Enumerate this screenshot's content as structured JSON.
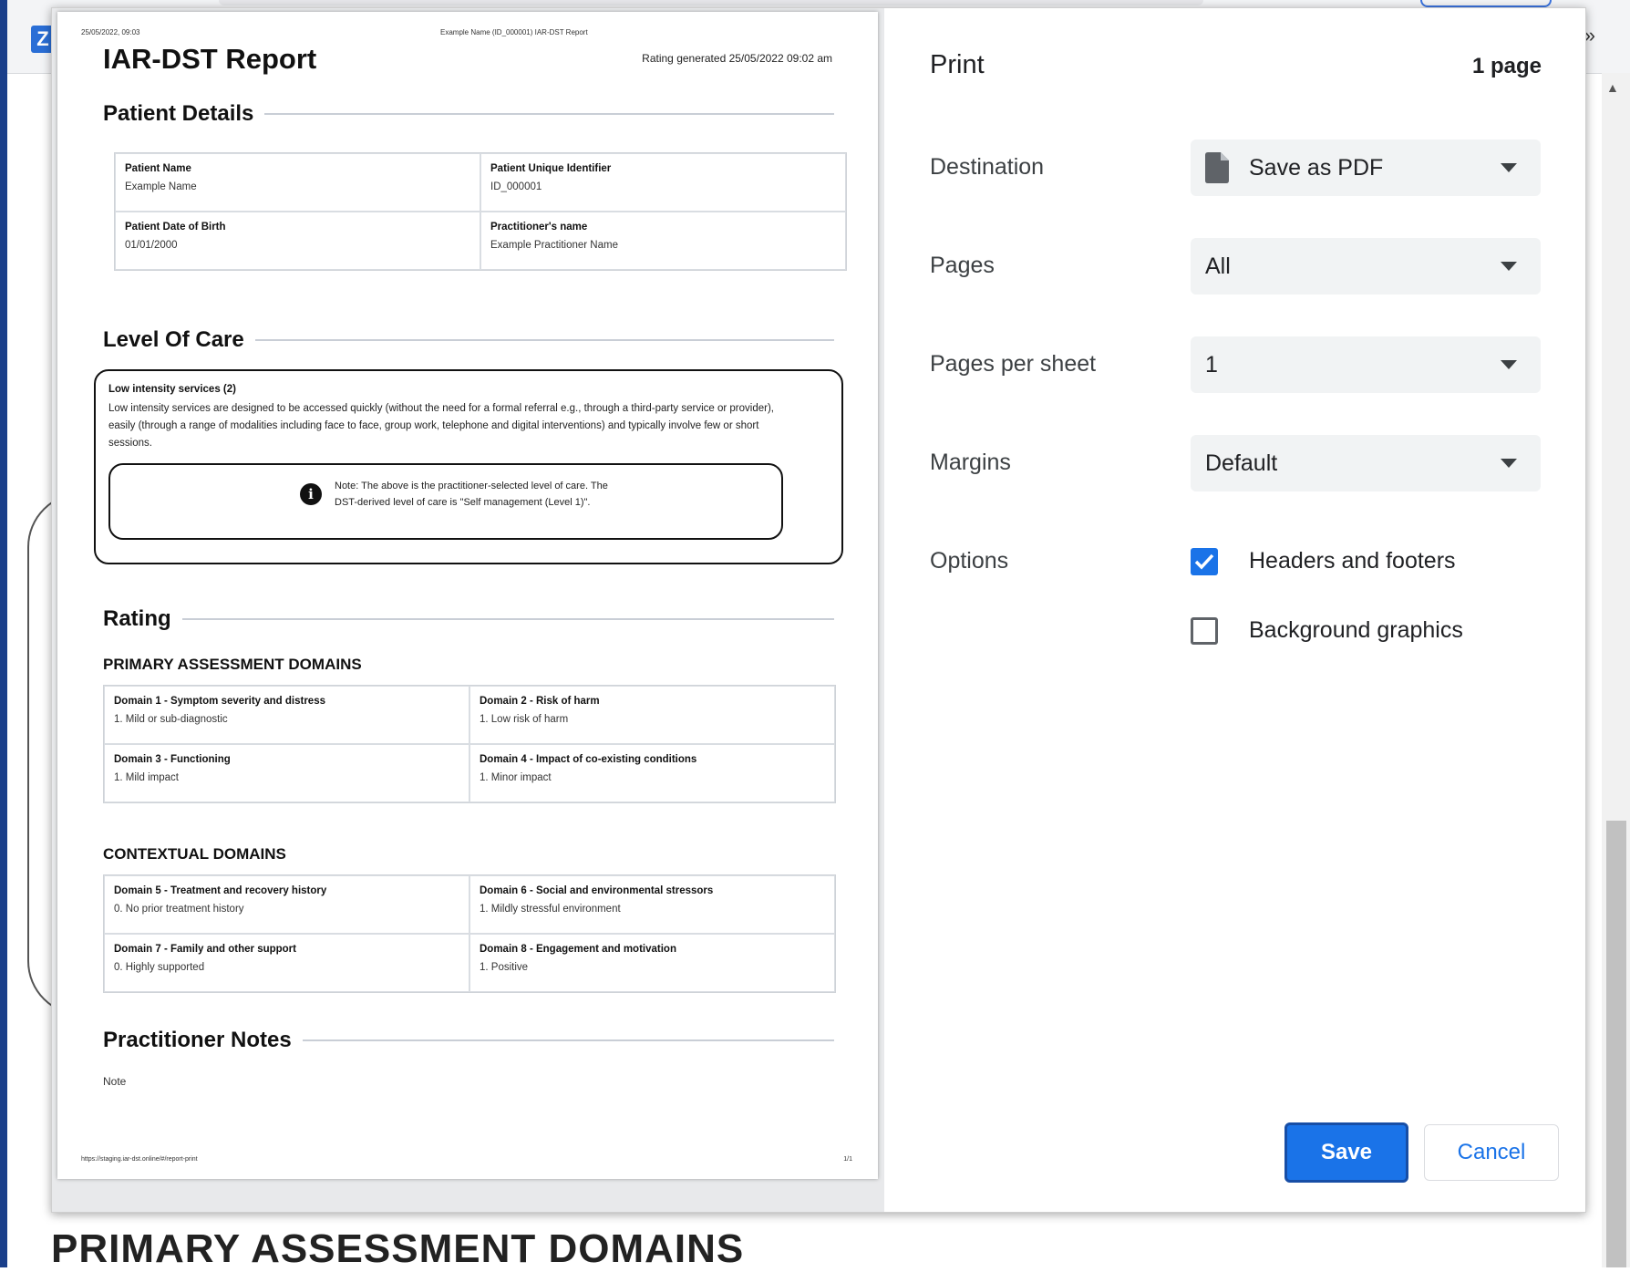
{
  "background": {
    "heading": "PRIMARY ASSESSMENT DOMAINS"
  },
  "preview": {
    "header_left": "25/05/2022, 09:03",
    "header_center": "Example Name (ID_000001) IAR-DST Report",
    "footer_left": "https://staging.iar-dst.online/#/report-print",
    "footer_right": "1/1",
    "title": "IAR-DST Report",
    "rating_generated": "Rating generated 25/05/2022 09:02 am",
    "patient_details": {
      "heading": "Patient Details",
      "fields": [
        {
          "label": "Patient Name",
          "value": "Example Name"
        },
        {
          "label": "Patient Unique Identifier",
          "value": "ID_000001"
        },
        {
          "label": "Patient Date of Birth",
          "value": "01/01/2000"
        },
        {
          "label": "Practitioner's name",
          "value": "Example Practitioner Name"
        }
      ]
    },
    "level_of_care": {
      "heading": "Level Of Care",
      "title": "Low intensity services (2)",
      "description": "Low intensity services are designed to be accessed quickly (without the need for a formal referral e.g., through a third-party service or provider), easily (through a range of modalities including face to face, group work, telephone and digital interventions) and typically involve few or short sessions.",
      "note": "Note: The above is the practitioner-selected level of care. The DST-derived level of care is \"Self management (Level 1)\"."
    },
    "rating": {
      "heading": "Rating",
      "primary_heading": "PRIMARY ASSESSMENT DOMAINS",
      "primary": [
        {
          "label": "Domain 1 - Symptom severity and distress",
          "value": "1. Mild or sub-diagnostic"
        },
        {
          "label": "Domain 2 - Risk of harm",
          "value": "1. Low risk of harm"
        },
        {
          "label": "Domain 3 - Functioning",
          "value": "1. Mild impact"
        },
        {
          "label": "Domain 4 - Impact of co-existing conditions",
          "value": "1. Minor impact"
        }
      ],
      "contextual_heading": "CONTEXTUAL DOMAINS",
      "contextual": [
        {
          "label": "Domain 5 - Treatment and recovery history",
          "value": "0. No prior treatment history"
        },
        {
          "label": "Domain 6 - Social and environmental stressors",
          "value": "1. Mildly stressful environment"
        },
        {
          "label": "Domain 7 - Family and other support",
          "value": "0. Highly supported"
        },
        {
          "label": "Domain 8 - Engagement and motivation",
          "value": "1. Positive"
        }
      ]
    },
    "notes": {
      "heading": "Practitioner Notes",
      "value": "Note"
    }
  },
  "settings": {
    "title": "Print",
    "page_count": "1 page",
    "destination": {
      "label": "Destination",
      "value": "Save as PDF"
    },
    "pages": {
      "label": "Pages",
      "value": "All"
    },
    "pages_per_sheet": {
      "label": "Pages per sheet",
      "value": "1"
    },
    "margins": {
      "label": "Margins",
      "value": "Default"
    },
    "options": {
      "label": "Options",
      "headers_footers": {
        "label": "Headers and footers",
        "checked": true
      },
      "background_graphics": {
        "label": "Background graphics",
        "checked": false
      }
    },
    "save_label": "Save",
    "cancel_label": "Cancel"
  },
  "colors": {
    "accent": "#1a73e8",
    "select_bg": "#f1f3f4",
    "preview_bg": "#e8e9eb"
  }
}
